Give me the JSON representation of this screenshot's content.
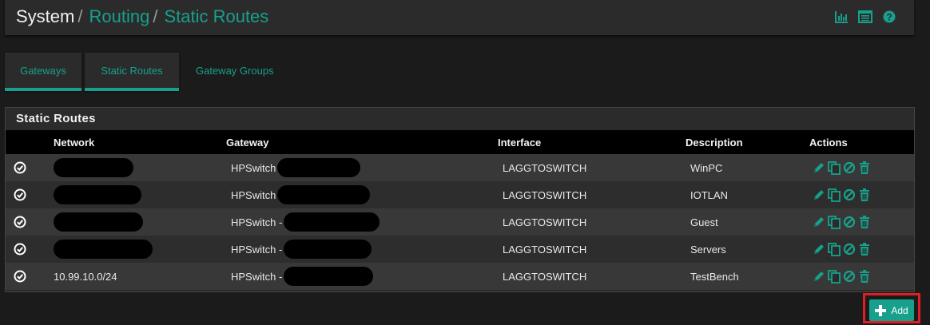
{
  "breadcrumb": {
    "root": "System",
    "sep": "/",
    "routing": "Routing",
    "current": "Static Routes"
  },
  "header_icons": [
    "bar-chart-icon",
    "list-icon",
    "help-icon"
  ],
  "tabs": [
    {
      "label": "Gateways"
    },
    {
      "label": "Static Routes"
    },
    {
      "label": "Gateway Groups"
    }
  ],
  "panel": {
    "title": "Static Routes",
    "columns": {
      "network": "Network",
      "gateway": "Gateway",
      "interface": "Interface",
      "description": "Description",
      "actions": "Actions"
    },
    "rows": [
      {
        "network": "",
        "gateway": "HPSwitch",
        "interface": "LAGGTOSWITCH",
        "description": "WinPC"
      },
      {
        "network": "",
        "gateway": "HPSwitch",
        "interface": "LAGGTOSWITCH",
        "description": "IOTLAN"
      },
      {
        "network": "",
        "gateway": "HPSwitch -",
        "interface": "LAGGTOSWITCH",
        "description": "Guest"
      },
      {
        "network": "",
        "gateway": "HPSwitch -",
        "interface": "LAGGTOSWITCH",
        "description": "Servers"
      },
      {
        "network": "10.99.10.0/24",
        "gateway": "HPSwitch -",
        "interface": "LAGGTOSWITCH",
        "description": "TestBench"
      }
    ]
  },
  "add_button": {
    "label": "Add"
  },
  "colors": {
    "accent": "#17a08c",
    "background": "#1b1b1b",
    "panel": "#2b2b2b",
    "highlight": "#e01e25"
  }
}
